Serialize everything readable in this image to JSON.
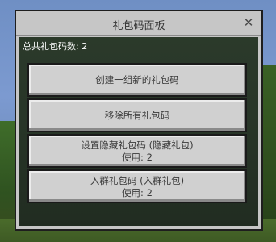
{
  "dialog": {
    "title": "礼包码面板",
    "close_glyph": "✕",
    "total_label": "总共礼包码数: 2"
  },
  "buttons": [
    {
      "label": "创建一组新的礼包码"
    },
    {
      "label": "移除所有礼包码"
    },
    {
      "label": "设置隐藏礼包码 (隐藏礼包)",
      "usage": "使用: 2"
    },
    {
      "label": "入群礼包码 (入群礼包)",
      "usage": "使用: 2"
    }
  ]
}
